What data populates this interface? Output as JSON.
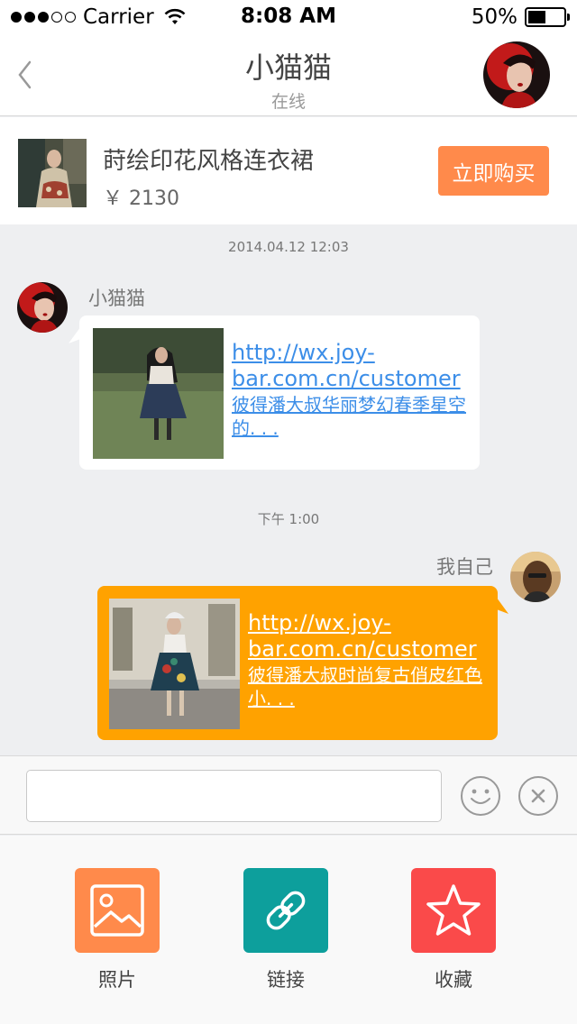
{
  "status_bar": {
    "carrier": "Carrier",
    "time": "8:08 AM",
    "battery": "50%",
    "battery_level": 0.5,
    "signal_bars_filled": 3,
    "signal_bars_total": 5
  },
  "header": {
    "title": "小猫猫",
    "status": "在线"
  },
  "product": {
    "name": "莳绘印花风格连衣裙",
    "price": "￥ 2130",
    "buy_label": "立即购买"
  },
  "chat": {
    "timestamp1": "2014.04.12  12:03",
    "msg1": {
      "sender": "小猫猫",
      "link_url": "http://wx.joy-bar.com.cn/customer",
      "link_desc": "彼得潘大叔华丽梦幻春季星空的. . ."
    },
    "timestamp2": "下午  1:00",
    "msg2": {
      "sender": "我自己",
      "link_url": "http://wx.joy-bar.com.cn/customer",
      "link_desc": "彼得潘大叔时尚复古俏皮红色小. . ."
    }
  },
  "input": {
    "placeholder": "",
    "value": ""
  },
  "attachments": {
    "photo": "照片",
    "link": "链接",
    "favorite": "收藏"
  },
  "colors": {
    "accent_orange": "#ff8a4b",
    "bubble_mine": "#ffa200",
    "link_blue": "#3c8ee8",
    "photo_tile": "#ff8a4b",
    "link_tile": "#0d9f9c",
    "favorite_tile": "#fa4a4a"
  },
  "icons": {
    "back": "chevron-left-icon",
    "emoji": "smiley-icon",
    "close": "close-icon",
    "photo": "image-icon",
    "link": "link-icon",
    "favorite": "star-icon"
  }
}
